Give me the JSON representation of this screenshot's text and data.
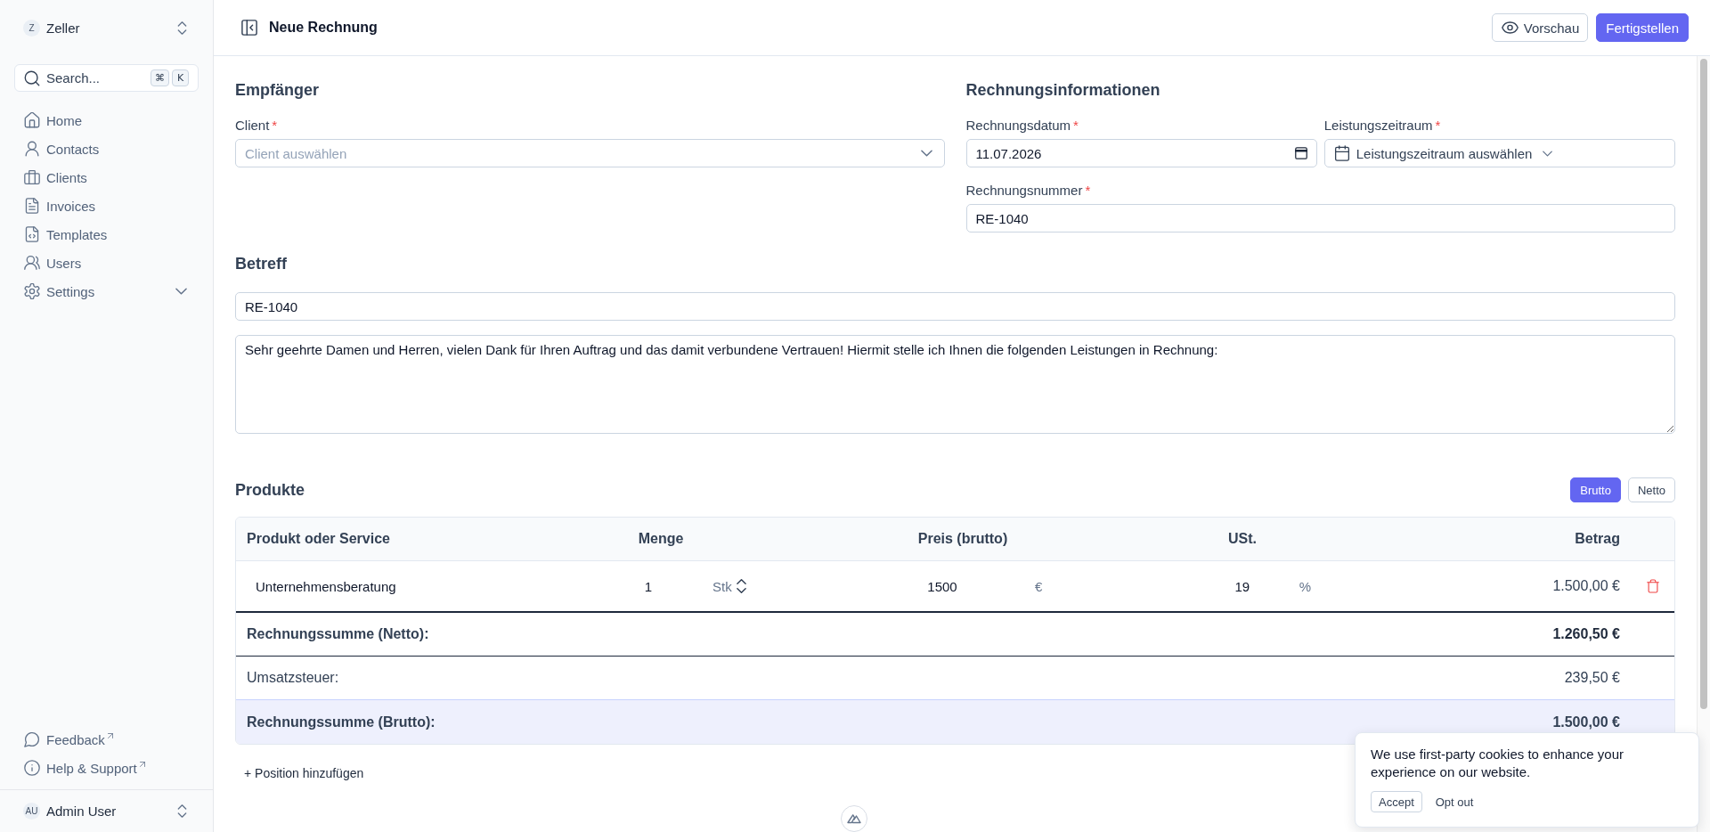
{
  "sidebar": {
    "workspace": {
      "initial": "Z",
      "name": "Zeller"
    },
    "search": {
      "placeholder": "Search...",
      "keys": [
        "⌘",
        "K"
      ]
    },
    "nav": [
      {
        "label": "Home",
        "kind": "link",
        "selected": false
      },
      {
        "label": "Contacts",
        "kind": "link",
        "selected": false
      },
      {
        "label": "Clients",
        "kind": "link",
        "selected": false
      },
      {
        "label": "Invoices",
        "kind": "link",
        "selected": false
      },
      {
        "label": "Templates",
        "kind": "link",
        "selected": false
      },
      {
        "label": "Users",
        "kind": "link",
        "selected": false
      },
      {
        "label": "Settings",
        "kind": "group",
        "selected": false,
        "expanded": false
      }
    ],
    "footer_links": [
      {
        "label": "Feedback",
        "external": true
      },
      {
        "label": "Help & Support",
        "external": true
      }
    ],
    "user": {
      "initials": "AU",
      "name": "Admin User"
    }
  },
  "header": {
    "title": "Neue Rechnung",
    "actions": [
      {
        "label": "Vorschau",
        "kind": "secondary"
      },
      {
        "label": "Fertigstellen",
        "kind": "primary"
      }
    ]
  },
  "recipient": {
    "heading": "Empfänger",
    "client": {
      "label": "Client",
      "required_mark": "*",
      "placeholder": "Client auswählen"
    }
  },
  "invoice_info": {
    "heading": "Rechnungsinformationen",
    "date": {
      "label": "Rechnungsdatum",
      "required_mark": "*",
      "value": "11.07.2026"
    },
    "service_period": {
      "label": "Leistungszeitraum",
      "required_mark": "*",
      "button_label": "Leistungszeitraum auswählen"
    },
    "number": {
      "label": "Rechnungsnummer",
      "required_mark": "*",
      "value": "RE-1040"
    }
  },
  "subject": {
    "heading": "Betreff",
    "value": "RE-1040",
    "intro_text": "Sehr geehrte Damen und Herren, vielen Dank für Ihren Auftrag und das damit verbundene Vertrauen! Hiermit stelle ich Ihnen die folgenden Leistungen in Rechnung:"
  },
  "products": {
    "heading": "Produkte",
    "price_modes": [
      {
        "label": "Brutto",
        "selected": true
      },
      {
        "label": "Netto",
        "selected": false
      }
    ],
    "table": {
      "columns": [
        "Produkt oder Service",
        "Menge",
        "Preis (brutto)",
        "USt.",
        "Betrag"
      ],
      "rows": [
        {
          "product": "Unternehmensberatung",
          "quantity": "1",
          "unit": "Stk",
          "price": "1500",
          "currency": "€",
          "vat_rate": "19",
          "vat_unit": "%",
          "amount": "1.500,00 €"
        }
      ],
      "totals": [
        {
          "kind": "net",
          "label": "Rechnungssumme (Netto):",
          "value": "1.260,50 €"
        },
        {
          "kind": "tax",
          "label": "Umsatzsteuer:",
          "value": "239,50 €"
        },
        {
          "kind": "gross",
          "label": "Rechnungssumme (Brutto):",
          "value": "1.500,00 €"
        }
      ]
    },
    "add_button": "+ Position hinzufügen"
  },
  "cookie_banner": {
    "text": "We use first-party cookies to enhance your experience on our website.",
    "actions": [
      {
        "label": "Accept",
        "kind": "outlined"
      },
      {
        "label": "Opt out",
        "kind": "plain"
      }
    ]
  }
}
